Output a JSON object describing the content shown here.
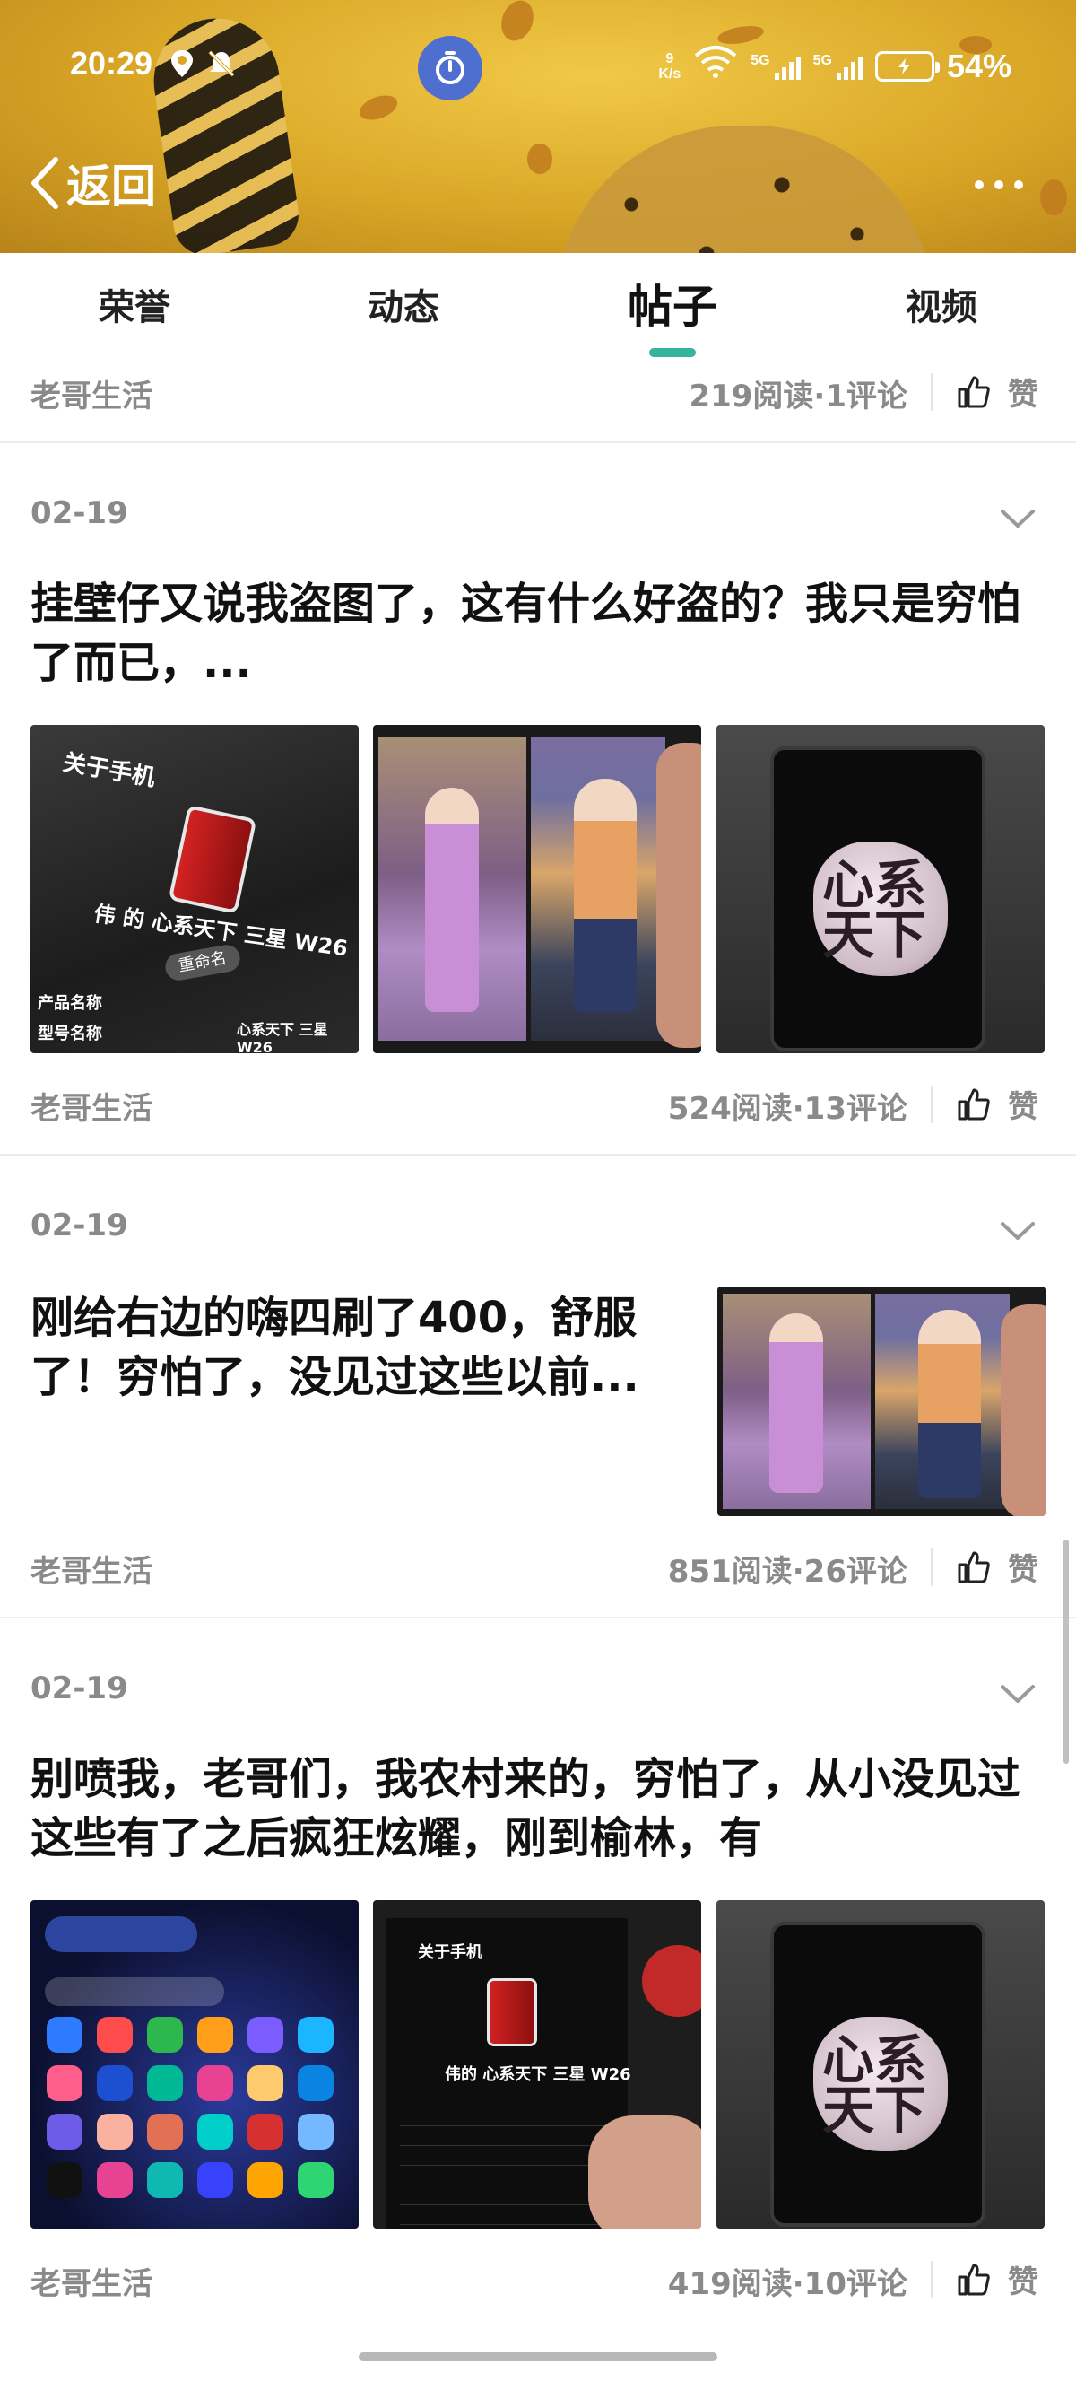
{
  "status_bar": {
    "time": "20:29",
    "net_speed_value": "9",
    "net_speed_unit": "K/s",
    "signal1_label": "5G",
    "signal2_label": "5G",
    "battery_level": "54%"
  },
  "header": {
    "back_label": "返回"
  },
  "tabs": [
    {
      "label": "荣誉",
      "active": false
    },
    {
      "label": "动态",
      "active": false
    },
    {
      "label": "帖子",
      "active": true
    },
    {
      "label": "视频",
      "active": false
    }
  ],
  "posts": [
    {
      "author": "老哥生活",
      "stats": "219阅读·1评论",
      "like_label": "赞"
    },
    {
      "date": "02-19",
      "title": "挂壁仔又说我盗图了，这有什么好盗的？我只是穷怕了而已，...",
      "thumb1_title": "关于手机",
      "thumb1_name": "伟 的 心系天下 三星 W26",
      "thumb1_button": "重命名",
      "thumb1_row1_label": "产品名称",
      "thumb1_row2_label": "型号名称",
      "thumb1_row2_value": "心系天下 三星 W26",
      "thumb3_calligraphy": "心系天下",
      "author": "老哥生活",
      "stats": "524阅读·13评论",
      "like_label": "赞"
    },
    {
      "date": "02-19",
      "title": "刚给右边的嗨四刷了400，舒服了！穷怕了，没见过这些以前...",
      "author": "老哥生活",
      "stats": "851阅读·26评论",
      "like_label": "赞"
    },
    {
      "date": "02-19",
      "title": "别喷我，老哥们，我农村来的，穷怕了，从小没见过这些有了之后疯狂炫耀，刚到榆林，有",
      "thumb2_title": "关于手机",
      "thumb2_name": "伟的 心系天下 三星 W26",
      "thumb3_calligraphy": "心系天下",
      "author": "老哥生活",
      "stats": "419阅读·10评论",
      "like_label": "赞"
    }
  ],
  "colors": {
    "tab_indicator": "#33b59a",
    "meta_text": "#8a8a8a",
    "timer_button": "#4e6fd0"
  },
  "icons": {
    "back": "chevron-left-icon",
    "more": "more-dots-icon",
    "timer": "stopwatch-icon",
    "like": "thumbs-up-icon",
    "expand": "chevron-down-icon"
  }
}
